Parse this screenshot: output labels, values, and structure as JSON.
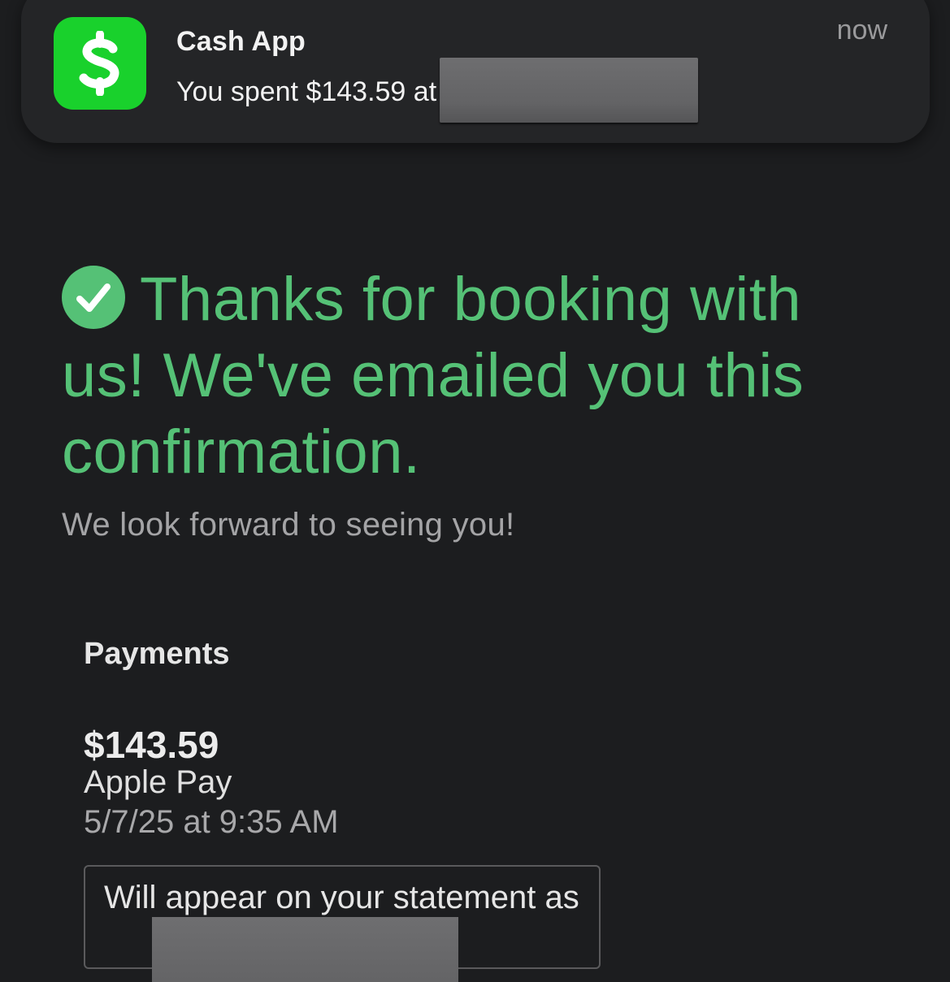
{
  "notification": {
    "app_name": "Cash App",
    "message": "You spent $143.59 at",
    "time": "now",
    "icon": "cash-app-dollar-icon",
    "icon_color": "#19d12c"
  },
  "confirmation": {
    "heading": "Thanks for booking with us! We've emailed you this confirmation.",
    "icon": "check-circle-icon",
    "accent_color": "#55c176",
    "subtitle": "We look forward to seeing you!"
  },
  "payments": {
    "heading": "Payments",
    "amount": "$143.59",
    "method": "Apple Pay",
    "datetime": "5/7/25 at 9:35 AM",
    "statement_prefix": "Will appear on your statement as"
  }
}
